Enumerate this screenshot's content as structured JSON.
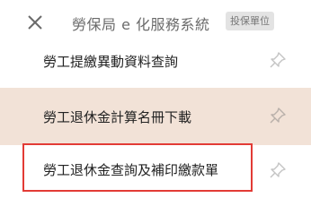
{
  "header": {
    "close_icon": "close-icon",
    "title": "勞保局 e 化服務系統",
    "badge": "投保單位"
  },
  "menu": {
    "items": [
      {
        "label": "勞工提繳異動資料查詢",
        "icon": "pin-icon"
      },
      {
        "label": "勞工退休金計算名冊下載",
        "icon": "pin-icon",
        "background": "#f2e2d7"
      },
      {
        "label": "勞工退休金查詢及補印繳款單",
        "icon": "pin-icon"
      }
    ]
  },
  "colors": {
    "highlight_border": "#e23b35",
    "hover_background": "#f2e2d7",
    "badge_background": "#e3e3e3"
  }
}
